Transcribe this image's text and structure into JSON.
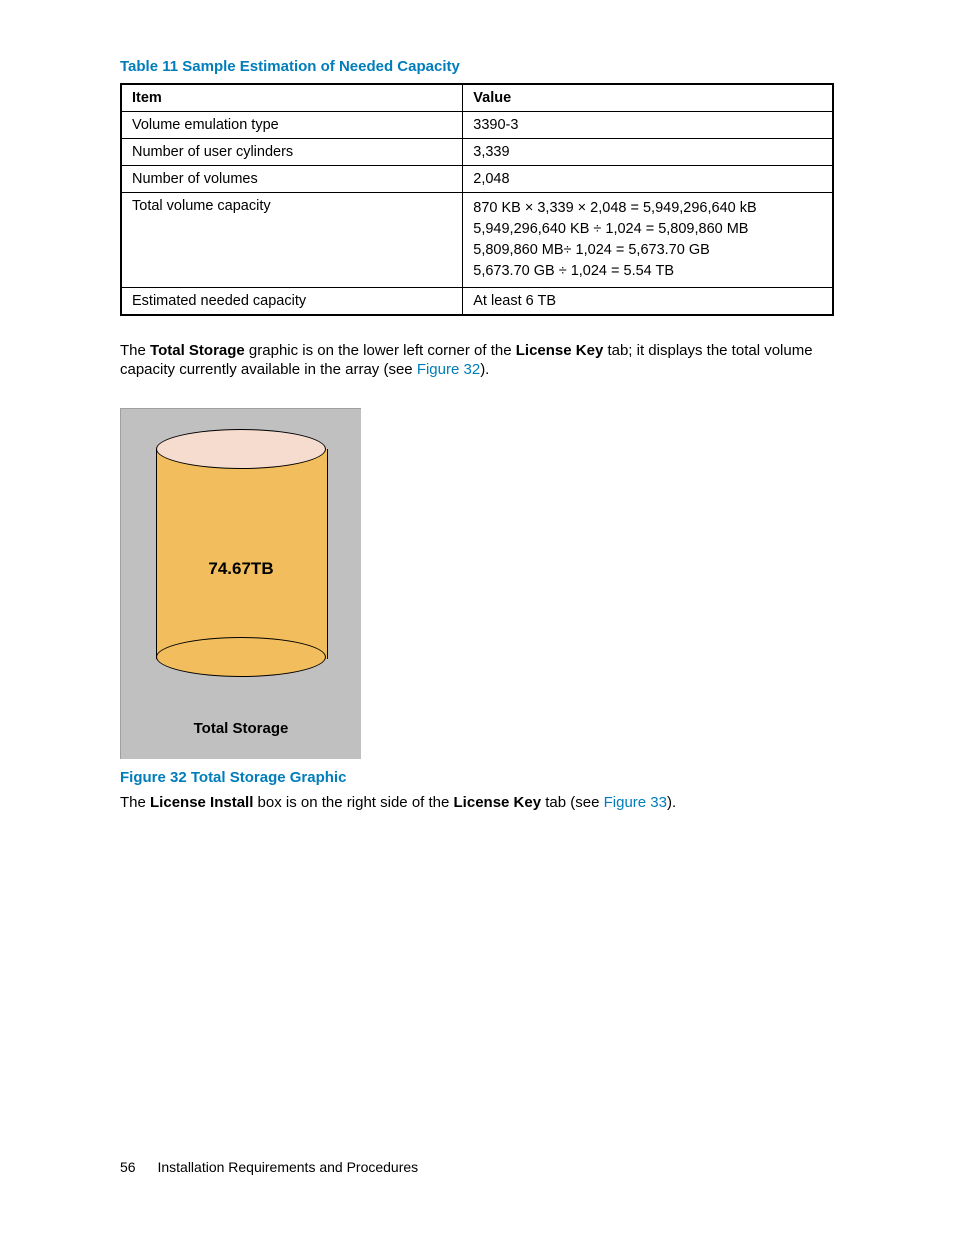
{
  "table": {
    "caption": "Table 11 Sample Estimation of Needed Capacity",
    "headers": {
      "item": "Item",
      "value": "Value"
    },
    "rows": [
      {
        "item": "Volume emulation type",
        "value": "3390-3"
      },
      {
        "item": "Number of user cylinders",
        "value": "3,339"
      },
      {
        "item": "Number of volumes",
        "value": "2,048"
      },
      {
        "item": "Total volume capacity",
        "value_lines": [
          "870 KB × 3,339 × 2,048 = 5,949,296,640 kB",
          "5,949,296,640 KB ÷ 1,024 = 5,809,860 MB",
          "5,809,860 MB÷ 1,024 = 5,673.70 GB",
          "5,673.70 GB ÷ 1,024 = 5.54 TB"
        ]
      },
      {
        "item": "Estimated needed capacity",
        "value": "At least 6 TB"
      }
    ]
  },
  "para1": {
    "pre": "The ",
    "b1": "Total Storage",
    "mid1": " graphic is on the lower left corner of the ",
    "b2": "License Key",
    "mid2": " tab; it displays the total volume capacity currently available in the array (see ",
    "link": "Figure 32",
    "post": ")."
  },
  "figure": {
    "cylinder_value": "74.67TB",
    "graphic_label": "Total Storage",
    "caption": "Figure 32 Total Storage Graphic"
  },
  "para2": {
    "pre": "The ",
    "b1": "License Install",
    "mid1": " box is on the right side of the ",
    "b2": "License Key",
    "mid2": " tab (see ",
    "link": "Figure 33",
    "post": ")."
  },
  "footer": {
    "page_number": "56",
    "section": "Installation Requirements and Procedures"
  }
}
